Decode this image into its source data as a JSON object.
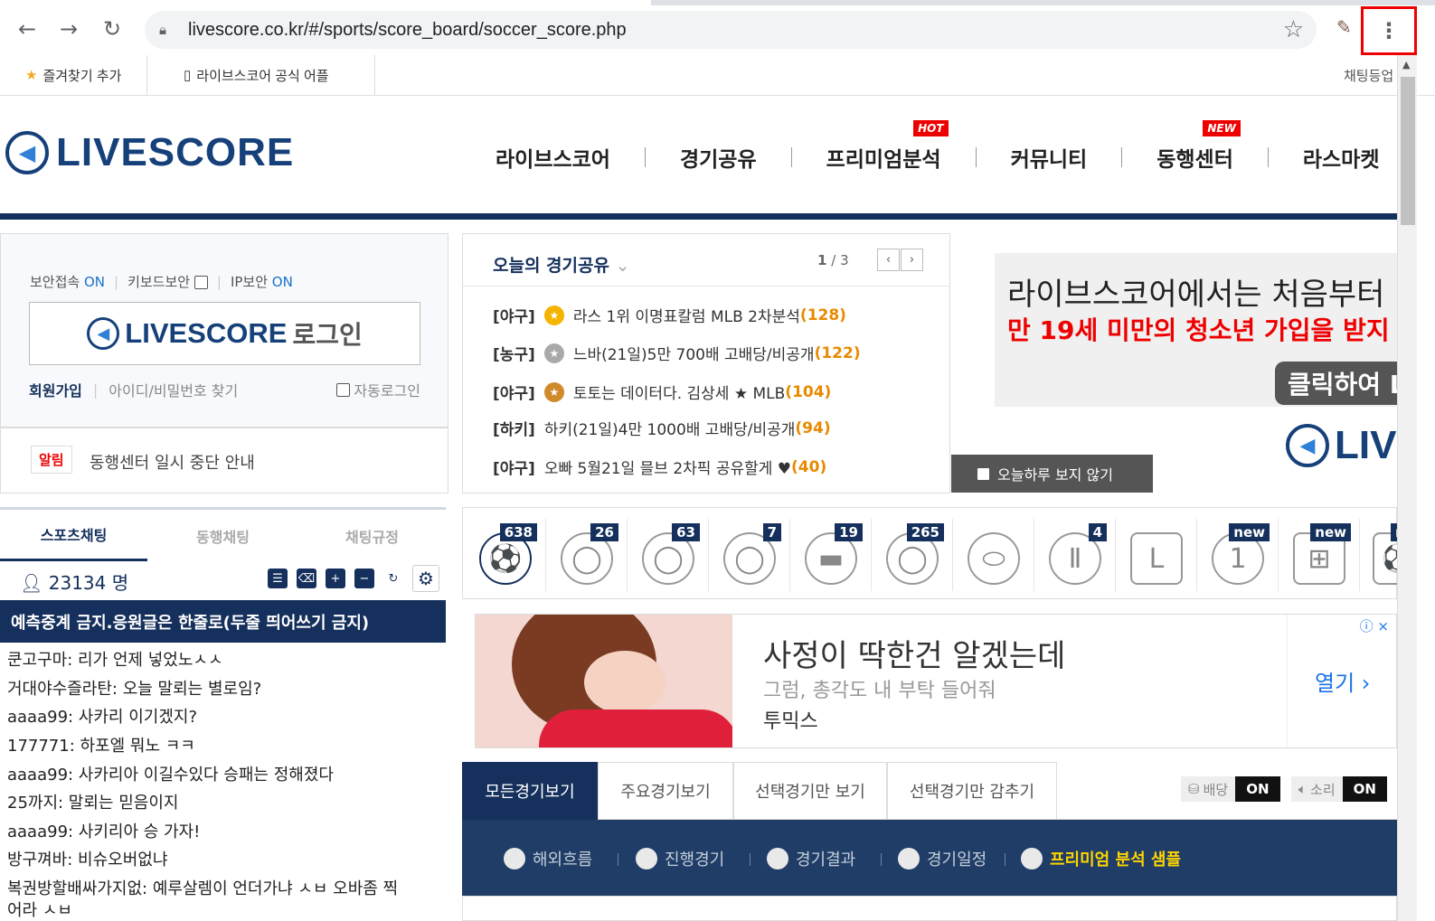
{
  "browser": {
    "url": "livescore.co.kr/#/sports/score_board/soccer_score.php",
    "bookmarks": [
      "즐겨찾기 추가",
      "라이브스코어 공식 어플"
    ],
    "bookmark_right": "채팅등업"
  },
  "site": {
    "logo": "LIVESCORE",
    "nav": [
      {
        "label": "라이브스코어",
        "badge": ""
      },
      {
        "label": "경기공유",
        "badge": ""
      },
      {
        "label": "프리미엄분석",
        "badge": "HOT"
      },
      {
        "label": "커뮤니티",
        "badge": ""
      },
      {
        "label": "동행센터",
        "badge": "NEW"
      },
      {
        "label": "라스마켓",
        "badge": ""
      }
    ]
  },
  "login": {
    "secure_label": "보안접속",
    "secure_state": "ON",
    "keyboard_label": "키보드보안",
    "ip_label": "IP보안",
    "ip_state": "ON",
    "button_logo": "LIVESCORE",
    "button_text": "로그인",
    "signup": "회원가입",
    "find": "아이디/비밀번호 찾기",
    "auto": "자동로그인"
  },
  "notice": {
    "tag": "알림",
    "text": "동행센터 일시 중단 안내"
  },
  "share": {
    "title": "오늘의 경기공유",
    "page_current": "1",
    "page_sep": "/",
    "page_total": "3",
    "items": [
      {
        "cat": "[야구]",
        "medal": "gold",
        "text": "라스 1위 이명표칼럼 MLB 2차분석",
        "count": "(128)"
      },
      {
        "cat": "[농구]",
        "medal": "silver",
        "text": "느바(21일)5만 700배 고배당/비공개",
        "count": "(122)"
      },
      {
        "cat": "[야구]",
        "medal": "bronze",
        "text": "토토는 데이터다. 김상세 ★ MLB",
        "count": "(104)"
      },
      {
        "cat": "[하키]",
        "medal": "",
        "text": "하키(21일)4만 1000배 고배당/비공개",
        "count": "(94)"
      },
      {
        "cat": "[야구]",
        "medal": "",
        "text": "오빠 5월21일 믈브 2차픽 공유할게 ♥",
        "count": "(40)"
      }
    ]
  },
  "ad_top": {
    "line1": "라이브스코어에서는 처음부터",
    "line2": "만 19세 미만의 청소년 가입을 받지",
    "cta": "클릭하여 L",
    "logo": "LIV",
    "hide_today": "오늘하루 보지 않기"
  },
  "chat": {
    "tabs": [
      "스포츠채팅",
      "동행채팅",
      "채팅규정"
    ],
    "users": "23134 명",
    "banner": "예측중계 금지.응원글은 한줄로(두줄 띄어쓰기 금지)",
    "lines": [
      "쿤고구마:  리가 언제 넣었노ㅅㅅ",
      "거대야수즐라탄:  오늘 말뢰는 별로임?",
      "aaaa99:  사카리 이기겠지?",
      "177771:  하포엘 뭐노 ㅋㅋ",
      "aaaa99:  사카리아 이길수있다 승패는 정해졌다",
      "25까지:  말뢰는 믿음이지",
      "aaaa99:  사키리아 승 가자!",
      "방구껴바:  비슈오버없냐",
      "복권방할배싸가지없:  예루살렘이 언더가냐 ㅅㅂ 오바좀 찍",
      "어라 ㅅㅂ"
    ]
  },
  "sports": [
    {
      "name": "soccer",
      "badge": "638",
      "glyph": "⚽"
    },
    {
      "name": "baseball",
      "badge": "26",
      "glyph": "◯"
    },
    {
      "name": "basketball",
      "badge": "63",
      "glyph": "◯"
    },
    {
      "name": "volleyball",
      "badge": "7",
      "glyph": "◯"
    },
    {
      "name": "hockey",
      "badge": "19",
      "glyph": "▬"
    },
    {
      "name": "tennis",
      "badge": "265",
      "glyph": "◯"
    },
    {
      "name": "football",
      "badge": "",
      "glyph": "⬭"
    },
    {
      "name": "esports",
      "badge": "4",
      "glyph": "Ⅱ"
    },
    {
      "name": "lol",
      "badge": "",
      "glyph": "L"
    },
    {
      "name": "ladder",
      "badge": "new",
      "glyph": "1"
    },
    {
      "name": "lotto",
      "badge": "new",
      "glyph": "⊞"
    },
    {
      "name": "virtual",
      "badge": "n",
      "glyph": "⚽"
    }
  ],
  "ad_mid": {
    "headline": "사정이 딱한건 알겠는데",
    "sub": "그럼, 총각도 내 부탁 들어줘",
    "brand": "투믹스",
    "open": "열기 ›",
    "info": "ⓘ ×"
  },
  "match": {
    "tabs": [
      "모든경기보기",
      "주요경기보기",
      "선택경기만 보기",
      "선택경기만 감추기"
    ],
    "odds_label": "배당",
    "odds_state": "ON",
    "sound_label": "소리",
    "sound_state": "ON",
    "filters": [
      "해외흐름",
      "진행경기",
      "경기결과",
      "경기일정",
      "프리미엄 분석 샘플"
    ]
  },
  "colors": {
    "navy": "#15305c",
    "brand": "#15407a",
    "hot": "#e00000",
    "accent": "#e88a00"
  }
}
